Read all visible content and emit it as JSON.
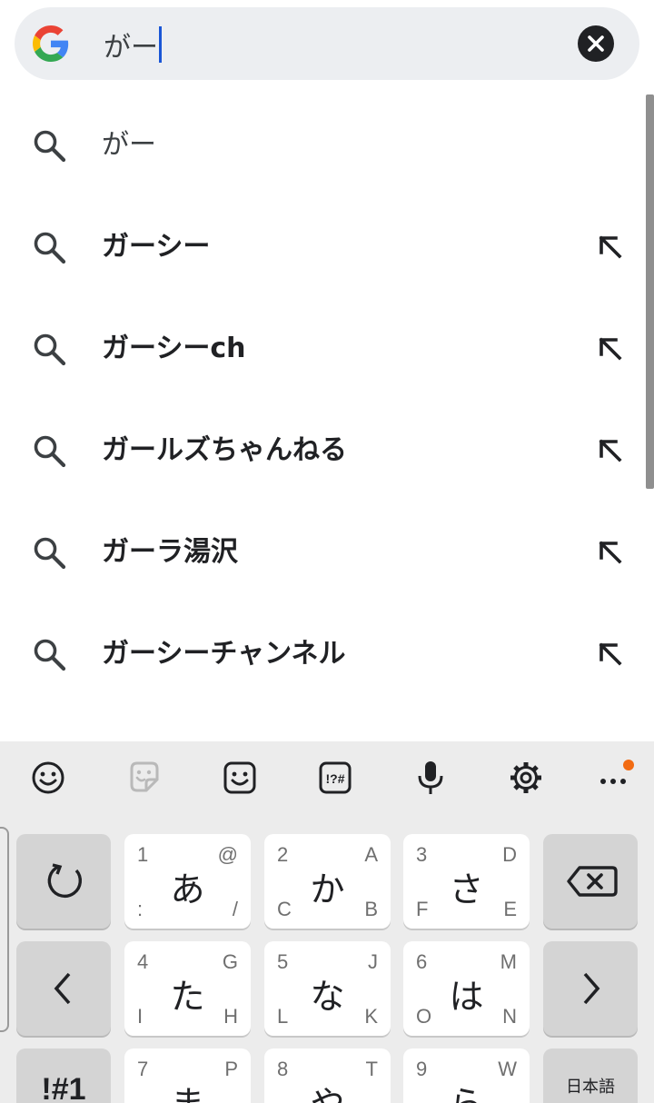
{
  "search": {
    "query": "がー",
    "logo": "google-g-icon",
    "clear_icon": "close-icon"
  },
  "suggestions": [
    {
      "text": "がー",
      "style": "plain",
      "has_fill_arrow": false
    },
    {
      "text": "ガーシー",
      "style": "bold",
      "has_fill_arrow": true
    },
    {
      "text": "ガーシーch",
      "style": "bold",
      "has_fill_arrow": true
    },
    {
      "text": "ガールズちゃんねる",
      "style": "bold",
      "has_fill_arrow": true
    },
    {
      "text": "ガーラ湯沢",
      "style": "bold",
      "has_fill_arrow": true
    },
    {
      "text": "ガーシーチャンネル",
      "style": "bold",
      "has_fill_arrow": true
    }
  ],
  "keyboard": {
    "toolbar": [
      "emoji-icon",
      "sticker-icon",
      "kaomoji-icon",
      "symbols-icon",
      "microphone-icon",
      "settings-icon",
      "more-icon"
    ],
    "keys": {
      "a": {
        "main": "あ",
        "tl": "1",
        "tr": "@",
        "bl": ":",
        "br": "/"
      },
      "ka": {
        "main": "か",
        "tl": "2",
        "tr": "A",
        "bl": "C",
        "br": "B"
      },
      "sa": {
        "main": "さ",
        "tl": "3",
        "tr": "D",
        "bl": "F",
        "br": "E"
      },
      "ta": {
        "main": "た",
        "tl": "4",
        "tr": "G",
        "bl": "I",
        "br": "H"
      },
      "na": {
        "main": "な",
        "tl": "5",
        "tr": "J",
        "bl": "L",
        "br": "K"
      },
      "ha": {
        "main": "は",
        "tl": "6",
        "tr": "M",
        "bl": "O",
        "br": "N"
      },
      "ma": {
        "main": "ま",
        "tl": "7",
        "tr": "P"
      },
      "ya": {
        "main": "や",
        "tl": "8",
        "tr": "T"
      },
      "ra": {
        "main": "ら",
        "tl": "9",
        "tr": "W"
      }
    },
    "mode_key": "!#1",
    "lang_key": "日本語"
  },
  "colors": {
    "accent_caret": "#1a56d6",
    "notification_dot": "#f26b12",
    "search_bar_bg": "#eceef1"
  }
}
